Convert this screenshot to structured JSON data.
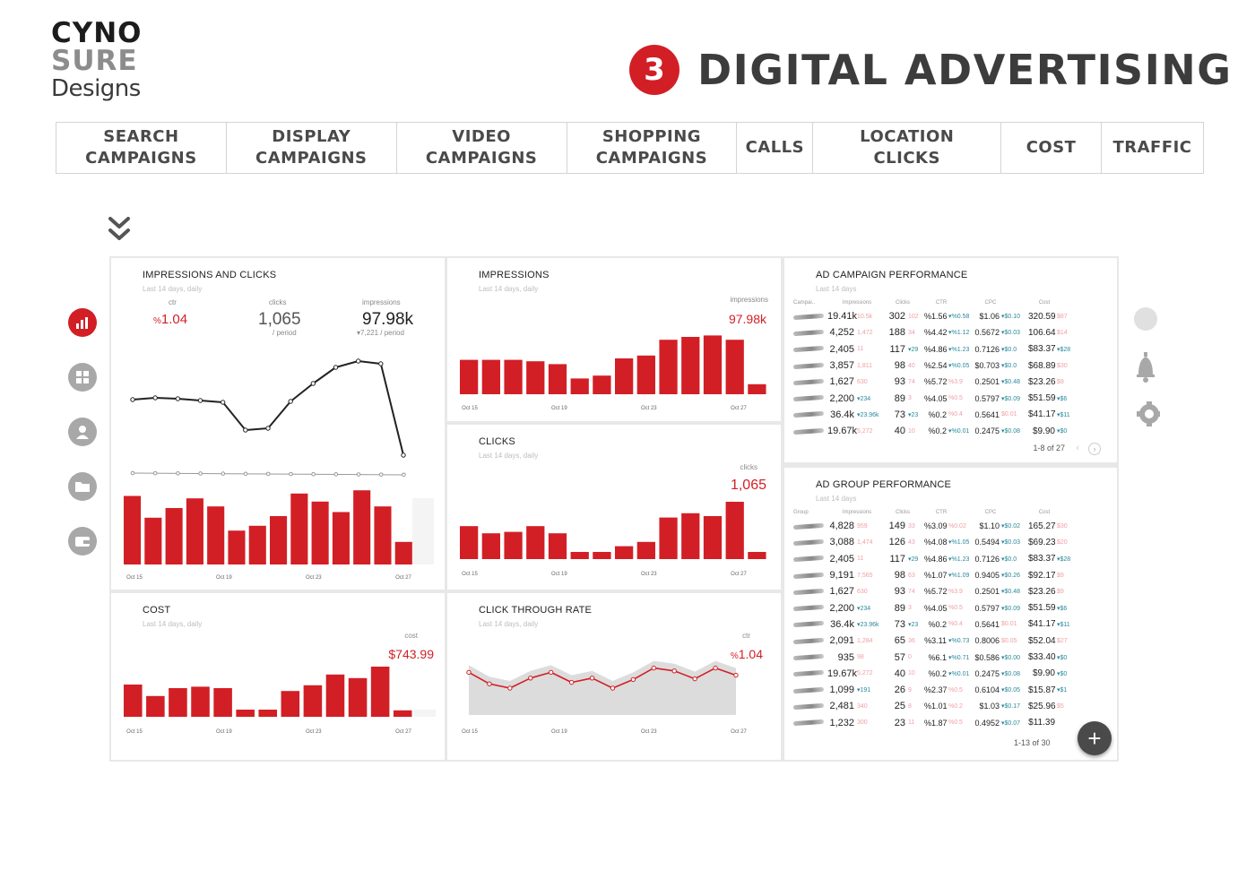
{
  "logo": {
    "line1": "CYNO",
    "line2": "SURE",
    "line3": "Designs"
  },
  "heading": {
    "number": "3",
    "title": "DIGITAL ADVERTISING"
  },
  "nav": [
    {
      "line1": "SEARCH",
      "line2": "CAMPAIGNS"
    },
    {
      "line1": "DISPLAY",
      "line2": "CAMPAIGNS"
    },
    {
      "line1": "VIDEO",
      "line2": "CAMPAIGNS"
    },
    {
      "line1": "SHOPPING",
      "line2": "CAMPAIGNS"
    },
    {
      "line1": "CALLS",
      "line2": ""
    },
    {
      "line1": "LOCATION",
      "line2": "CLICKS"
    },
    {
      "line1": "COST",
      "line2": ""
    },
    {
      "line1": "TRAFFIC",
      "line2": ""
    }
  ],
  "left_rail": [
    "bar-chart-icon",
    "grid-icon",
    "person-icon",
    "folder-icon",
    "wallet-icon"
  ],
  "right_rail": [
    "circle-icon",
    "bell-icon",
    "gear-icon"
  ],
  "colors": {
    "accent": "#d21f26",
    "teal": "#2a8a9a",
    "muted": "#a8a8a8"
  },
  "cards": {
    "impressions_clicks": {
      "title": "IMPRESSIONS AND CLICKS",
      "subtitle": "Last 14 days, daily",
      "kpis": {
        "ctr_label": "ctr",
        "ctr_value": "1.04",
        "clicks_label": "clicks",
        "clicks_value": "1,065",
        "clicks_sub": "/ period",
        "impr_label": "impressions",
        "impr_value": "97.98k",
        "impr_sub": "▾7,221 / period"
      }
    },
    "impressions": {
      "title": "IMPRESSIONS",
      "subtitle": "Last 14 days, daily",
      "label": "impressions",
      "value": "97.98k"
    },
    "clicks": {
      "title": "CLICKS",
      "subtitle": "Last 14 days, daily",
      "label": "clicks",
      "value": "1,065"
    },
    "cost": {
      "title": "COST",
      "subtitle": "Last 14 days, daily",
      "label": "cost",
      "value": "$743.99"
    },
    "ctr": {
      "title": "CLICK THROUGH RATE",
      "subtitle": "Last 14 days, daily",
      "label": "ctr",
      "value": "1.04"
    },
    "ad_campaign": {
      "title": "AD CAMPAIGN PERFORMANCE",
      "subtitle": "Last 14 days",
      "headers": [
        "Campai..",
        "Impressions",
        "Clicks",
        "CTR",
        "CPC",
        "Cost"
      ],
      "rows": [
        [
          "19.41k",
          "10.5k",
          "302",
          "102",
          "%1.56",
          "▾%0.58",
          "$1.06",
          "▾$0.10",
          "320.59",
          "$87"
        ],
        [
          "4,252",
          "1,472",
          "188",
          "34",
          "%4.42",
          "▾%1.12",
          "0.5672",
          "▾$0.03",
          "106.64",
          "$14"
        ],
        [
          "2,405",
          "11",
          "117",
          "▾29",
          "%4.86",
          "▾%1.23",
          "0.7126",
          "▾$0.0",
          "$83.37",
          "▾$28"
        ],
        [
          "3,857",
          "1,811",
          "98",
          "40",
          "%2.54",
          "▾%0.05",
          "$0.703",
          "▾$0.0",
          "$68.89",
          "$30"
        ],
        [
          "1,627",
          "630",
          "93",
          "74",
          "%5.72",
          "%3.9",
          "0.2501",
          "▾$0.48",
          "$23.26",
          "$9"
        ],
        [
          "2,200",
          "▾234",
          "89",
          "3",
          "%4.05",
          "%0.5",
          "0.5797",
          "▾$0.09",
          "$51.59",
          "▾$6"
        ],
        [
          "36.4k",
          "▾23.96k",
          "73",
          "▾23",
          "%0.2",
          "%0.4",
          "0.5641",
          "$0.01",
          "$41.17",
          "▾$11"
        ],
        [
          "19.67k",
          "5,272",
          "40",
          "10",
          "%0.2",
          "▾%0.01",
          "0.2475",
          "▾$0.08",
          "$9.90",
          "▾$0"
        ]
      ],
      "pagination": "1-8 of 27"
    },
    "ad_group": {
      "title": "AD GROUP PERFORMANCE",
      "subtitle": "Last 14 days",
      "headers": [
        "Group",
        "Impressions",
        "Clicks",
        "CTR",
        "CPC",
        "Cost"
      ],
      "rows": [
        [
          "4,828",
          "959",
          "149",
          "33",
          "%3.09",
          "%0.02",
          "$1.10",
          "▾$0.02",
          "165.27",
          "$30"
        ],
        [
          "3,088",
          "1,474",
          "126",
          "43",
          "%4.08",
          "▾%1.05",
          "0.5494",
          "▾$0.03",
          "$69.23",
          "$20"
        ],
        [
          "2,405",
          "11",
          "117",
          "▾29",
          "%4.86",
          "▾%1.23",
          "0.7126",
          "▾$0.0",
          "$83.37",
          "▾$28"
        ],
        [
          "9,191",
          "7,565",
          "98",
          "63",
          "%1.07",
          "▾%1.09",
          "0.9405",
          "▾$0.26",
          "$92.17",
          "$9"
        ],
        [
          "1,627",
          "630",
          "93",
          "74",
          "%5.72",
          "%3.9",
          "0.2501",
          "▾$0.48",
          "$23.26",
          "$9"
        ],
        [
          "2,200",
          "▾234",
          "89",
          "3",
          "%4.05",
          "%0.5",
          "0.5797",
          "▾$0.09",
          "$51.59",
          "▾$6"
        ],
        [
          "36.4k",
          "▾23.96k",
          "73",
          "▾23",
          "%0.2",
          "%0.4",
          "0.5641",
          "$0.01",
          "$41.17",
          "▾$11"
        ],
        [
          "2,091",
          "1,284",
          "65",
          "36",
          "%3.11",
          "▾%0.73",
          "0.8006",
          "$0.05",
          "$52.04",
          "$27"
        ],
        [
          "935",
          "98",
          "57",
          "0",
          "%6.1",
          "▾%0.71",
          "$0.586",
          "▾$0.00",
          "$33.40",
          "▾$0"
        ],
        [
          "19.67k",
          "5,272",
          "40",
          "10",
          "%0.2",
          "▾%0.01",
          "0.2475",
          "▾$0.08",
          "$9.90",
          "▾$0"
        ],
        [
          "1,099",
          "▾191",
          "26",
          "9",
          "%2.37",
          "%0.5",
          "0.6104",
          "▾$0.05",
          "$15.87",
          "▾$1"
        ],
        [
          "2,481",
          "340",
          "25",
          "8",
          "%1.01",
          "%0.2",
          "$1.03",
          "▾$0.17",
          "$25.96",
          "$5"
        ],
        [
          "1,232",
          "300",
          "23",
          "11",
          "%1.87",
          "%0.5",
          "0.4952",
          "▾$0.07",
          "$11.39",
          ""
        ]
      ],
      "pagination": "1-13 of 30"
    }
  },
  "x_ticks": [
    "Oct 15",
    "Oct 19",
    "Oct 23",
    "Oct 27"
  ],
  "chart_data": [
    {
      "type": "bar",
      "name": "impressions_clicks_bars",
      "values": [
        85,
        58,
        70,
        82,
        72,
        42,
        48,
        60,
        88,
        78,
        65,
        92,
        72,
        28
      ]
    },
    {
      "type": "line",
      "name": "impressions_clicks_line",
      "values": [
        52,
        54,
        53,
        51,
        49,
        18,
        20,
        50,
        70,
        88,
        95,
        92,
        -10
      ]
    },
    {
      "type": "bar",
      "name": "impressions",
      "values": [
        48,
        48,
        48,
        46,
        42,
        22,
        26,
        50,
        54,
        76,
        80,
        82,
        76,
        14
      ]
    },
    {
      "type": "bar",
      "name": "clicks",
      "values": [
        46,
        36,
        38,
        46,
        36,
        10,
        10,
        18,
        24,
        58,
        64,
        60,
        80,
        10
      ]
    },
    {
      "type": "bar",
      "name": "cost",
      "values": [
        45,
        29,
        40,
        42,
        40,
        10,
        10,
        36,
        44,
        59,
        54,
        70,
        9
      ]
    },
    {
      "type": "line",
      "name": "ctr",
      "values": [
        52,
        36,
        30,
        44,
        52,
        38,
        44,
        30,
        42,
        58,
        54,
        43,
        58,
        48
      ]
    }
  ]
}
